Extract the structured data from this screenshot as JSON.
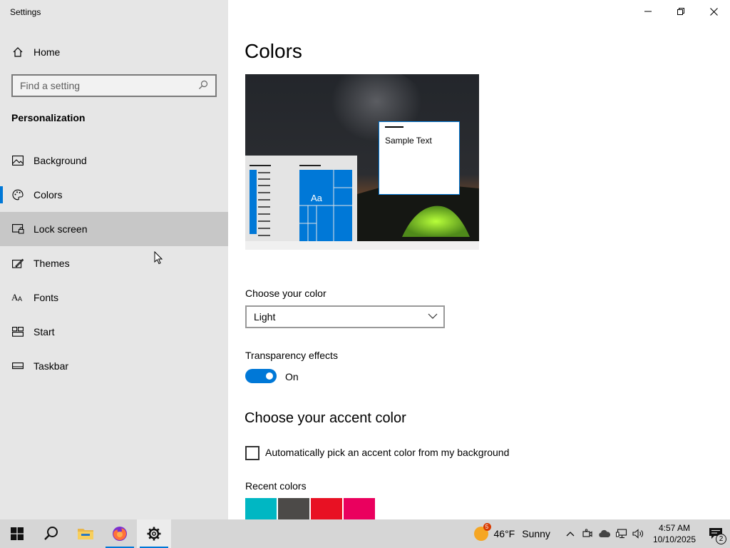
{
  "window": {
    "title": "Settings"
  },
  "sidebar": {
    "home_label": "Home",
    "search_placeholder": "Find a setting",
    "section_title": "Personalization",
    "items": [
      {
        "label": "Background",
        "icon": "image-icon",
        "state": "normal"
      },
      {
        "label": "Colors",
        "icon": "palette-icon",
        "state": "selected"
      },
      {
        "label": "Lock screen",
        "icon": "lock-screen-icon",
        "state": "hover"
      },
      {
        "label": "Themes",
        "icon": "themes-icon",
        "state": "normal"
      },
      {
        "label": "Fonts",
        "icon": "fonts-icon",
        "state": "normal"
      },
      {
        "label": "Start",
        "icon": "start-icon",
        "state": "normal"
      },
      {
        "label": "Taskbar",
        "icon": "taskbar-icon",
        "state": "normal"
      }
    ]
  },
  "main": {
    "title": "Colors",
    "preview": {
      "sample_text": "Sample Text",
      "tile_text": "Aa"
    },
    "choose_color": {
      "label": "Choose your color",
      "value": "Light"
    },
    "transparency": {
      "label": "Transparency effects",
      "state": "On"
    },
    "accent_title": "Choose your accent color",
    "auto_pick": {
      "label": "Automatically pick an accent color from my background",
      "checked": false
    },
    "recent_colors": {
      "label": "Recent colors",
      "colors": [
        "#00b7c3",
        "#4c4a48",
        "#e81123",
        "#ea005e"
      ]
    }
  },
  "taskbar": {
    "weather": {
      "badge": "5",
      "temp": "46°F",
      "condition": "Sunny"
    },
    "clock": {
      "time": "4:57 AM",
      "date": "10/10/2025"
    },
    "notifications": {
      "count": "2"
    }
  },
  "colors": {
    "accent": "#0078d7",
    "sidebar_bg": "#e6e6e6",
    "hover_bg": "#c7c7c7",
    "taskbar_bg": "#d6d6d6"
  }
}
